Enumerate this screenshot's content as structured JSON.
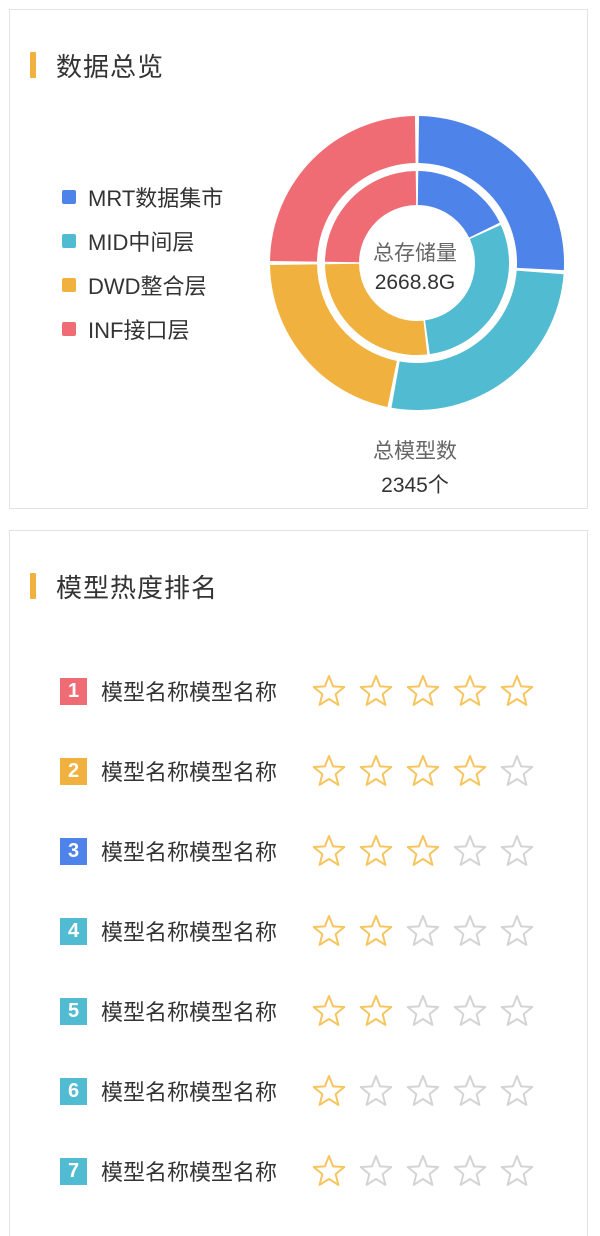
{
  "overview": {
    "title": "数据总览",
    "legend": [
      {
        "label": "MRT数据集市",
        "color": "#4e83ea"
      },
      {
        "label": "MID中间层",
        "color": "#51bcd1"
      },
      {
        "label": "DWD整合层",
        "color": "#f1b13e"
      },
      {
        "label": "INF接口层",
        "color": "#f06c75"
      }
    ],
    "center_label": "总存储量",
    "center_value": "2668.8G",
    "bottom_label": "总模型数",
    "bottom_value": "2345个"
  },
  "ranking": {
    "title": "模型热度排名",
    "star_color_filled": "#f7c55e",
    "star_color_empty": "#d4d4d4",
    "items": [
      {
        "rank": "1",
        "name": "模型名称模型名称",
        "stars": 5,
        "color": "#f06c75"
      },
      {
        "rank": "2",
        "name": "模型名称模型名称",
        "stars": 4,
        "color": "#f1b13e"
      },
      {
        "rank": "3",
        "name": "模型名称模型名称",
        "stars": 3,
        "color": "#4e83ea"
      },
      {
        "rank": "4",
        "name": "模型名称模型名称",
        "stars": 2,
        "color": "#51bcd1"
      },
      {
        "rank": "5",
        "name": "模型名称模型名称",
        "stars": 2,
        "color": "#51bcd1"
      },
      {
        "rank": "6",
        "name": "模型名称模型名称",
        "stars": 1,
        "color": "#51bcd1"
      },
      {
        "rank": "7",
        "name": "模型名称模型名称",
        "stars": 1,
        "color": "#51bcd1"
      }
    ]
  },
  "chart_data": {
    "type": "pie",
    "variant": "nested-donut",
    "categories": [
      "MRT数据集市",
      "MID中间层",
      "DWD整合层",
      "INF接口层"
    ],
    "series": [
      {
        "ring": "outer",
        "label": "总模型数",
        "values": [
          26,
          27,
          22,
          25
        ]
      },
      {
        "ring": "inner",
        "label": "总存储量",
        "values": [
          18,
          30,
          27,
          25
        ]
      }
    ],
    "colors": [
      "#4e83ea",
      "#51bcd1",
      "#f1b13e",
      "#f06c75"
    ]
  }
}
